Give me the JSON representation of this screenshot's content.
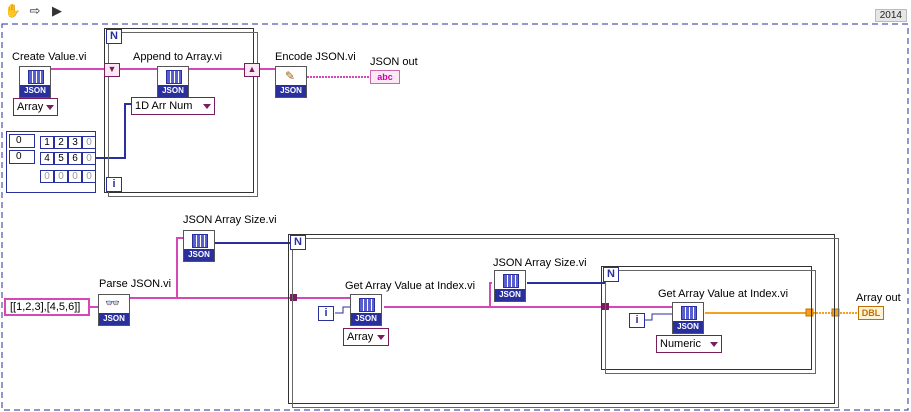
{
  "toolbar": {
    "version": "2014"
  },
  "nodes": {
    "create_value": "Create Value.vi",
    "append_to_array": "Append to Array.vi",
    "encode_json": "Encode JSON.vi",
    "json_out": "JSON out",
    "json_array_size_1": "JSON Array Size.vi",
    "parse_json": "Parse JSON.vi",
    "get_array_value_1": "Get Array Value at Index.vi",
    "json_array_size_2": "JSON Array Size.vi",
    "get_array_value_2": "Get Array Value at Index.vi",
    "array_out": "Array out"
  },
  "icon_text": {
    "json": "JSON"
  },
  "rings": {
    "array_type": "Array",
    "arr_num": "1D Arr Num",
    "array_type_2": "Array",
    "numeric": "Numeric"
  },
  "terminals": {
    "n": "N",
    "i": "i",
    "abc": "abc",
    "dbl": "DBL"
  },
  "constants": {
    "json_string": "[[1,2,3],[4,5,6]]"
  },
  "array_const": {
    "index0": "0",
    "index1": "0",
    "row1": [
      "1",
      "2",
      "3",
      "0"
    ],
    "row2": [
      "4",
      "5",
      "6",
      "0"
    ],
    "row3": [
      "0",
      "0",
      "0",
      "0"
    ]
  },
  "icons": [
    "hand-icon",
    "run-arrow-icon",
    "run-continuous-icon"
  ],
  "colors": {
    "json_wire": "#d548b5",
    "numeric_wire": "#f4a21d",
    "loop_border": "#333333",
    "json_icon": "#2a2f9e"
  }
}
